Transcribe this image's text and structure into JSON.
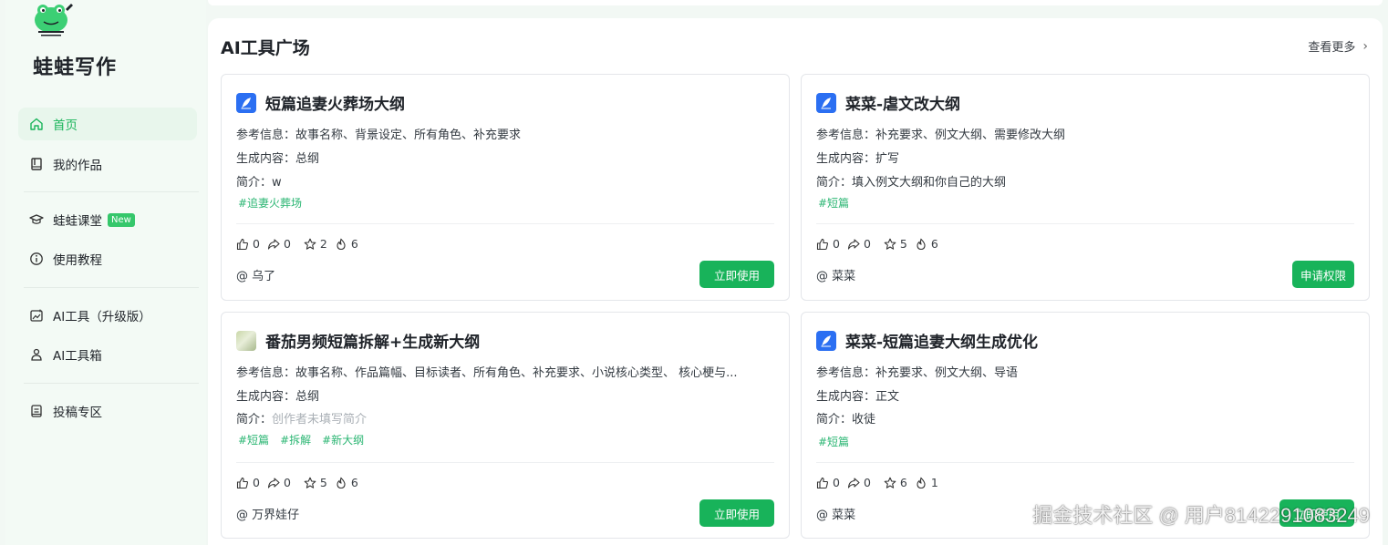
{
  "app": {
    "brand": "蛙蛙写作"
  },
  "sidebar": {
    "items": [
      {
        "label": "首页",
        "icon": "home-icon",
        "active": true
      },
      {
        "label": "我的作品",
        "icon": "book-icon",
        "active": false
      },
      {
        "label": "蛙蛙课堂",
        "icon": "graduation-cap-icon",
        "active": false,
        "badge": "New"
      },
      {
        "label": "使用教程",
        "icon": "info-icon",
        "active": false
      },
      {
        "label": "AI工具（升级版）",
        "icon": "ai-image-icon",
        "active": false
      },
      {
        "label": "AI工具箱",
        "icon": "toolbox-icon",
        "active": false
      },
      {
        "label": "投稿专区",
        "icon": "submit-icon",
        "active": false
      }
    ]
  },
  "main": {
    "title": "AI工具广场",
    "see_more": "查看更多"
  },
  "labels": {
    "ref": "参考信息：",
    "gen": "生成内容：",
    "intro": "简介："
  },
  "cards": [
    {
      "title": "短篇追妻火葬场大纲",
      "icon": "quill-icon",
      "ref": "故事名称、背景设定、所有角色、补充要求",
      "gen": "总纲",
      "intro": "w",
      "tags": [
        "#追妻火葬场"
      ],
      "likes": "0",
      "shares": "0",
      "stars": "2",
      "heat": "6",
      "author": "@ 乌了",
      "button": "立即使用"
    },
    {
      "title": "菜菜-虐文改大纲",
      "icon": "quill-icon",
      "ref": "补充要求、例文大纲、需要修改大纲",
      "gen": "扩写",
      "intro": "填入例文大纲和你自己的大纲",
      "tags": [
        "#短篇"
      ],
      "likes": "0",
      "shares": "0",
      "stars": "5",
      "heat": "6",
      "author": "@ 菜菜",
      "button": "申请权限"
    },
    {
      "title": "番茄男频短篇拆解+生成新大纲",
      "icon": "photo-thumbnail",
      "ref": "故事名称、作品篇幅、目标读者、所有角色、补充要求、小说核心类型、 核心梗与...",
      "gen": "总纲",
      "intro": "创作者未填写简介",
      "tags": [
        "#短篇",
        "#拆解",
        "#新大纲"
      ],
      "likes": "0",
      "shares": "0",
      "stars": "5",
      "heat": "6",
      "author": "@ 万界娃仔",
      "button": "立即使用"
    },
    {
      "title": "菜菜-短篇追妻大纲生成优化",
      "icon": "quill-icon",
      "ref": "补充要求、例文大纲、导语",
      "gen": "正文",
      "intro": "收徒",
      "tags": [
        "#短篇"
      ],
      "likes": "0",
      "shares": "0",
      "stars": "6",
      "heat": "1",
      "author": "@ 菜菜",
      "button": "立即使用"
    }
  ],
  "watermark": "掘金技术社区 @ 用户8142291083249",
  "colors": {
    "accent": "#18b35a",
    "tag": "#2bb673",
    "icon_blue": "#2b6ff2"
  }
}
